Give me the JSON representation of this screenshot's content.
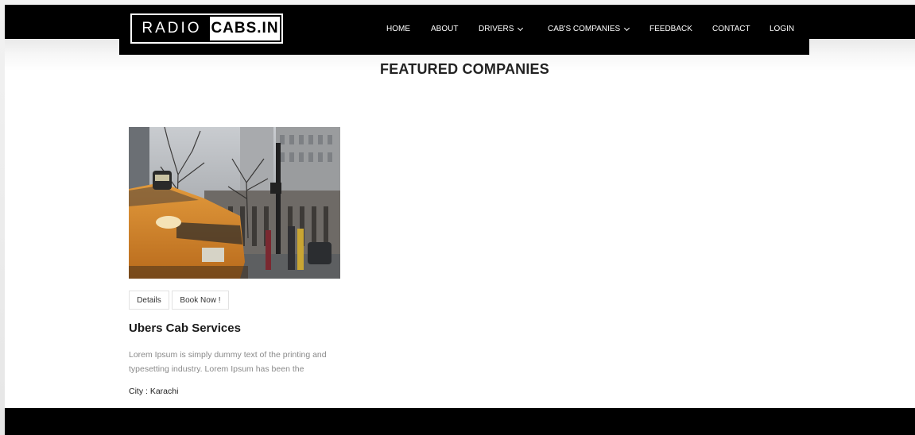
{
  "brand": {
    "logo_left": "RADIO",
    "logo_right": "CABS.IN"
  },
  "nav": {
    "items": [
      {
        "label": "HOME",
        "dropdown": false
      },
      {
        "label": "ABOUT",
        "dropdown": false
      },
      {
        "label": "DRIVERS",
        "dropdown": true
      },
      {
        "label": "CAB'S COMPANIES",
        "dropdown": true
      },
      {
        "label": "FEEDBACK",
        "dropdown": false
      },
      {
        "label": "CONTACT",
        "dropdown": false
      },
      {
        "label": "LOGIN",
        "dropdown": false
      }
    ]
  },
  "main": {
    "title": "FEATURED COMPANIES",
    "card": {
      "details_label": "Details",
      "book_label": "Book Now !",
      "title": "Ubers Cab Services",
      "description": "Lorem Ipsum is simply dummy text of the printing and typesetting industry. Lorem Ipsum has been the",
      "city": "City : Karachi"
    }
  },
  "colors": {
    "header": "#000000",
    "footer": "#000000",
    "background": "#ffffff",
    "taxi": "#d98a2b"
  }
}
